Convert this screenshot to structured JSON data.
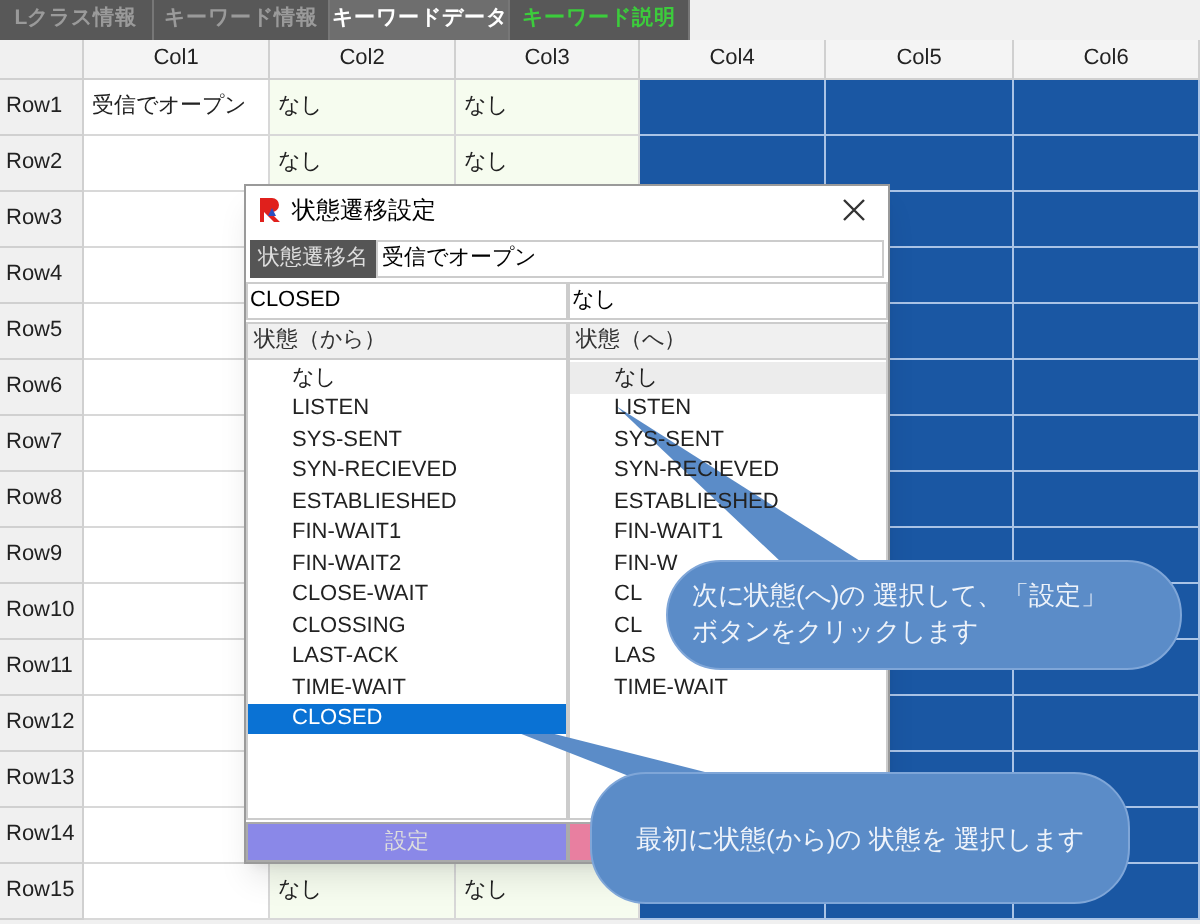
{
  "tabs": [
    {
      "label": "Lクラス情報",
      "selected": false,
      "kind": "dimmed"
    },
    {
      "label": "キーワード情報",
      "selected": false,
      "kind": "dimmed"
    },
    {
      "label": "キーワードデータ",
      "selected": true,
      "kind": "normal"
    },
    {
      "label": "キーワード説明",
      "selected": false,
      "kind": "accent"
    }
  ],
  "grid": {
    "columns": [
      {
        "label": "Col1",
        "color": "#ffffff"
      },
      {
        "label": "Col2",
        "color": "#f6fcef"
      },
      {
        "label": "Col3",
        "color": "#f6fcef"
      },
      {
        "label": "Col4",
        "color": "#1a57a3"
      },
      {
        "label": "Col5",
        "color": "#1a57a3"
      },
      {
        "label": "Col6",
        "color": "#1a57a3"
      }
    ],
    "rows": [
      {
        "header": "Row1",
        "col1": "受信でオープン",
        "col2": "なし",
        "col3": "なし"
      },
      {
        "header": "Row2",
        "col2": "なし",
        "col3": "なし"
      },
      {
        "header": "Row3"
      },
      {
        "header": "Row4"
      },
      {
        "header": "Row5"
      },
      {
        "header": "Row6"
      },
      {
        "header": "Row7"
      },
      {
        "header": "Row8"
      },
      {
        "header": "Row9"
      },
      {
        "header": "Row10"
      },
      {
        "header": "Row11"
      },
      {
        "header": "Row12"
      },
      {
        "header": "Row13"
      },
      {
        "header": "Row14"
      },
      {
        "header": "Row15",
        "col2": "なし",
        "col3": "なし"
      }
    ]
  },
  "dialog": {
    "title": "状態遷移設定",
    "name_label": "状態遷移名",
    "name_value": "受信でオープン",
    "from_value": "CLOSED",
    "to_value": "なし",
    "from_list": {
      "header": "状態（から）",
      "items": [
        {
          "label": "なし",
          "selected": false
        },
        {
          "label": "LISTEN",
          "selected": false
        },
        {
          "label": "SYS-SENT",
          "selected": false
        },
        {
          "label": "SYN-RECIEVED",
          "selected": false
        },
        {
          "label": "ESTABLIESHED",
          "selected": false
        },
        {
          "label": "FIN-WAIT1",
          "selected": false
        },
        {
          "label": "FIN-WAIT2",
          "selected": false
        },
        {
          "label": "CLOSE-WAIT",
          "selected": false
        },
        {
          "label": "CLOSSING",
          "selected": false
        },
        {
          "label": "LAST-ACK",
          "selected": false
        },
        {
          "label": "TIME-WAIT",
          "selected": false
        },
        {
          "label": "CLOSED",
          "selected": true
        }
      ]
    },
    "to_list": {
      "header": "状態（へ）",
      "items": [
        {
          "label": "なし",
          "selected": true
        },
        {
          "label": "LISTEN",
          "selected": false
        },
        {
          "label": "SYS-SENT",
          "selected": false
        },
        {
          "label": "SYN-RECIEVED",
          "selected": false
        },
        {
          "label": "ESTABLIESHED",
          "selected": false
        },
        {
          "label": "FIN-WAIT1",
          "selected": false
        },
        {
          "label": "FIN-W",
          "selected": false
        },
        {
          "label": "CL",
          "selected": false
        },
        {
          "label": "CL",
          "selected": false
        },
        {
          "label": "LAS",
          "selected": false
        },
        {
          "label": "TIME-WAIT",
          "selected": false
        }
      ]
    },
    "buttons": [
      {
        "label": "設定",
        "kind": "set"
      },
      {
        "kind": "cancel"
      }
    ]
  },
  "callouts": [
    {
      "lines": [
        "次に状態(へ)の 選択して、「設定」",
        "ボタンをクリックします"
      ]
    },
    {
      "lines": [
        "最初に状態(から)の 状態を 選択します"
      ]
    }
  ]
}
